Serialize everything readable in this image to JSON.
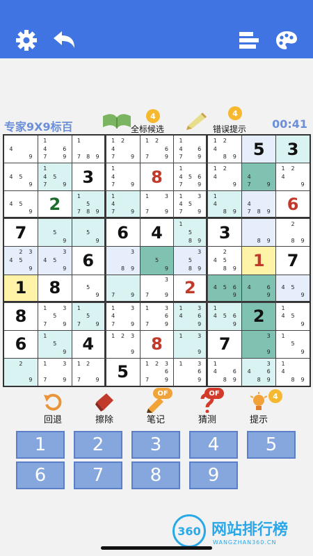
{
  "header": {
    "settings_icon": "gear-icon",
    "undo_icon": "back-arrow-icon",
    "stats_icon": "bars-icon",
    "theme_icon": "palette-icon"
  },
  "level_label": "专家9X9标百",
  "timer": "00:41",
  "tools": [
    {
      "label": "全标候选",
      "badge": "4",
      "icon": "book-icon"
    },
    {
      "label": "错误提示",
      "badge": "4",
      "icon": "pencil-icon"
    }
  ],
  "colors": {
    "header": "#3f74e2",
    "numkey": "#86a7de",
    "cell_light": "#d9f2f2",
    "cell_teal": "#7fc2b2",
    "cell_yellow": "#fff3a8",
    "cell_blue": "#e6eefc"
  },
  "grid": [
    [
      {
        "c": "4 9"
      },
      {
        "c": "1 4 6 7 9"
      },
      {
        "c": "1 7 8 9"
      },
      {
        "c": "1 2 4 7 9"
      },
      {
        "c": "1 2 6 7 9"
      },
      {
        "c": "1 4 6 7 9"
      },
      {
        "c": "1 2 4 8 9"
      },
      {
        "v": "5",
        "bg": "blue"
      },
      {
        "v": "3",
        "bg": "light"
      }
    ],
    [
      {
        "c": "4 5 9"
      },
      {
        "c": "1 4 5 7 9",
        "bg": "light"
      },
      {
        "v": "3"
      },
      {
        "c": "1 4 7 9"
      },
      {
        "v": "8",
        "user": 1
      },
      {
        "c": "1 4 5 6 7 9"
      },
      {
        "c": "1 2 4 9"
      },
      {
        "c": "4 7 9",
        "bg": "teal"
      },
      {
        "c": "1 2 4 9"
      }
    ],
    [
      {
        "c": "4 5 9"
      },
      {
        "v": "2",
        "green": 1
      },
      {
        "c": "1 5 7 8 9",
        "bg": "light"
      },
      {
        "c": "1 4 7 9",
        "bg": "light"
      },
      {
        "c": "1 3 7 9"
      },
      {
        "c": "1 3 4 5 7 9"
      },
      {
        "c": "1 4 8 9",
        "bg": "light"
      },
      {
        "c": "4 7 8 9",
        "bg": "blue"
      },
      {
        "v": "6",
        "user": 1
      }
    ],
    [
      {
        "v": "7"
      },
      {
        "c": "5 9",
        "bg": "light"
      },
      {
        "c": "5 9",
        "bg": "light"
      },
      {
        "v": "6"
      },
      {
        "v": "4"
      },
      {
        "c": "1 5 8 9",
        "bg": "light"
      },
      {
        "v": "3"
      },
      {
        "c": "8 9",
        "bg": "blue"
      },
      {
        "c": "2 8 9"
      }
    ],
    [
      {
        "c": "2 3 4 5 9",
        "bg": "blue"
      },
      {
        "c": "3 4 5 9",
        "bg": "blue"
      },
      {
        "v": "6"
      },
      {
        "c": "3 8 9",
        "bg": "blue"
      },
      {
        "c": "5 9",
        "bg": "teal"
      },
      {
        "c": "3 5 8 9",
        "bg": "blue"
      },
      {
        "c": "2 4 5 8 9"
      },
      {
        "v": "1",
        "user": 1,
        "bg": "yellow"
      },
      {
        "v": "7"
      }
    ],
    [
      {
        "v": "1",
        "bg": "yellow"
      },
      {
        "v": "8"
      },
      {
        "c": "5 9"
      },
      {
        "c": "7 9",
        "bg": "light"
      },
      {
        "c": "3 7 9"
      },
      {
        "v": "2",
        "user": 1
      },
      {
        "c": "4 5 6 9",
        "bg": "teal"
      },
      {
        "c": "4 6 9",
        "bg": "teal"
      },
      {
        "c": "4 5 9",
        "bg": "blue"
      }
    ],
    [
      {
        "v": "8"
      },
      {
        "c": "1 3 5 7 9"
      },
      {
        "c": "1 5 7 9",
        "bg": "light"
      },
      {
        "c": "1 3 4 7 9"
      },
      {
        "c": "1 3 6 7 9"
      },
      {
        "c": "1 3 4 6 9",
        "bg": "light"
      },
      {
        "c": "1 4 5 6 9",
        "bg": "light"
      },
      {
        "v": "2",
        "bg": "teal"
      },
      {
        "c": "1 4 5 9"
      }
    ],
    [
      {
        "v": "6"
      },
      {
        "c": "1 5 9",
        "bg": "light"
      },
      {
        "v": "4"
      },
      {
        "c": "1 2 3 9"
      },
      {
        "v": "8",
        "user": 1
      },
      {
        "c": "1 3 9",
        "bg": "light"
      },
      {
        "v": "7"
      },
      {
        "c": "3 9",
        "bg": "teal"
      },
      {
        "c": "1 5 9"
      }
    ],
    [
      {
        "c": "2 9",
        "bg": "light"
      },
      {
        "c": "1 3 7 9"
      },
      {
        "c": "1 2 7 9"
      },
      {
        "v": "5"
      },
      {
        "c": "1 2 3 6 7 9"
      },
      {
        "c": "1 3 6 9"
      },
      {
        "c": "1 4 6 8 9"
      },
      {
        "c": "3 4 6 8 9",
        "bg": "light"
      },
      {
        "c": "1 4 8 9"
      }
    ]
  ],
  "actions": [
    {
      "label": "回退",
      "icon": "undo-icon"
    },
    {
      "label": "擦除",
      "icon": "eraser-icon"
    },
    {
      "label": "笔记",
      "icon": "pencil-icon",
      "badge": "OF"
    },
    {
      "label": "猜测",
      "icon": "question-icon",
      "badge": "OF"
    },
    {
      "label": "提示",
      "icon": "lightbulb-icon",
      "badge": "4"
    }
  ],
  "numpad": [
    "1",
    "2",
    "3",
    "4",
    "5",
    "6",
    "7",
    "8",
    "9"
  ],
  "watermark": {
    "logo": "360",
    "title": "网站排行榜",
    "url": "WANGZHAN360.CN"
  }
}
